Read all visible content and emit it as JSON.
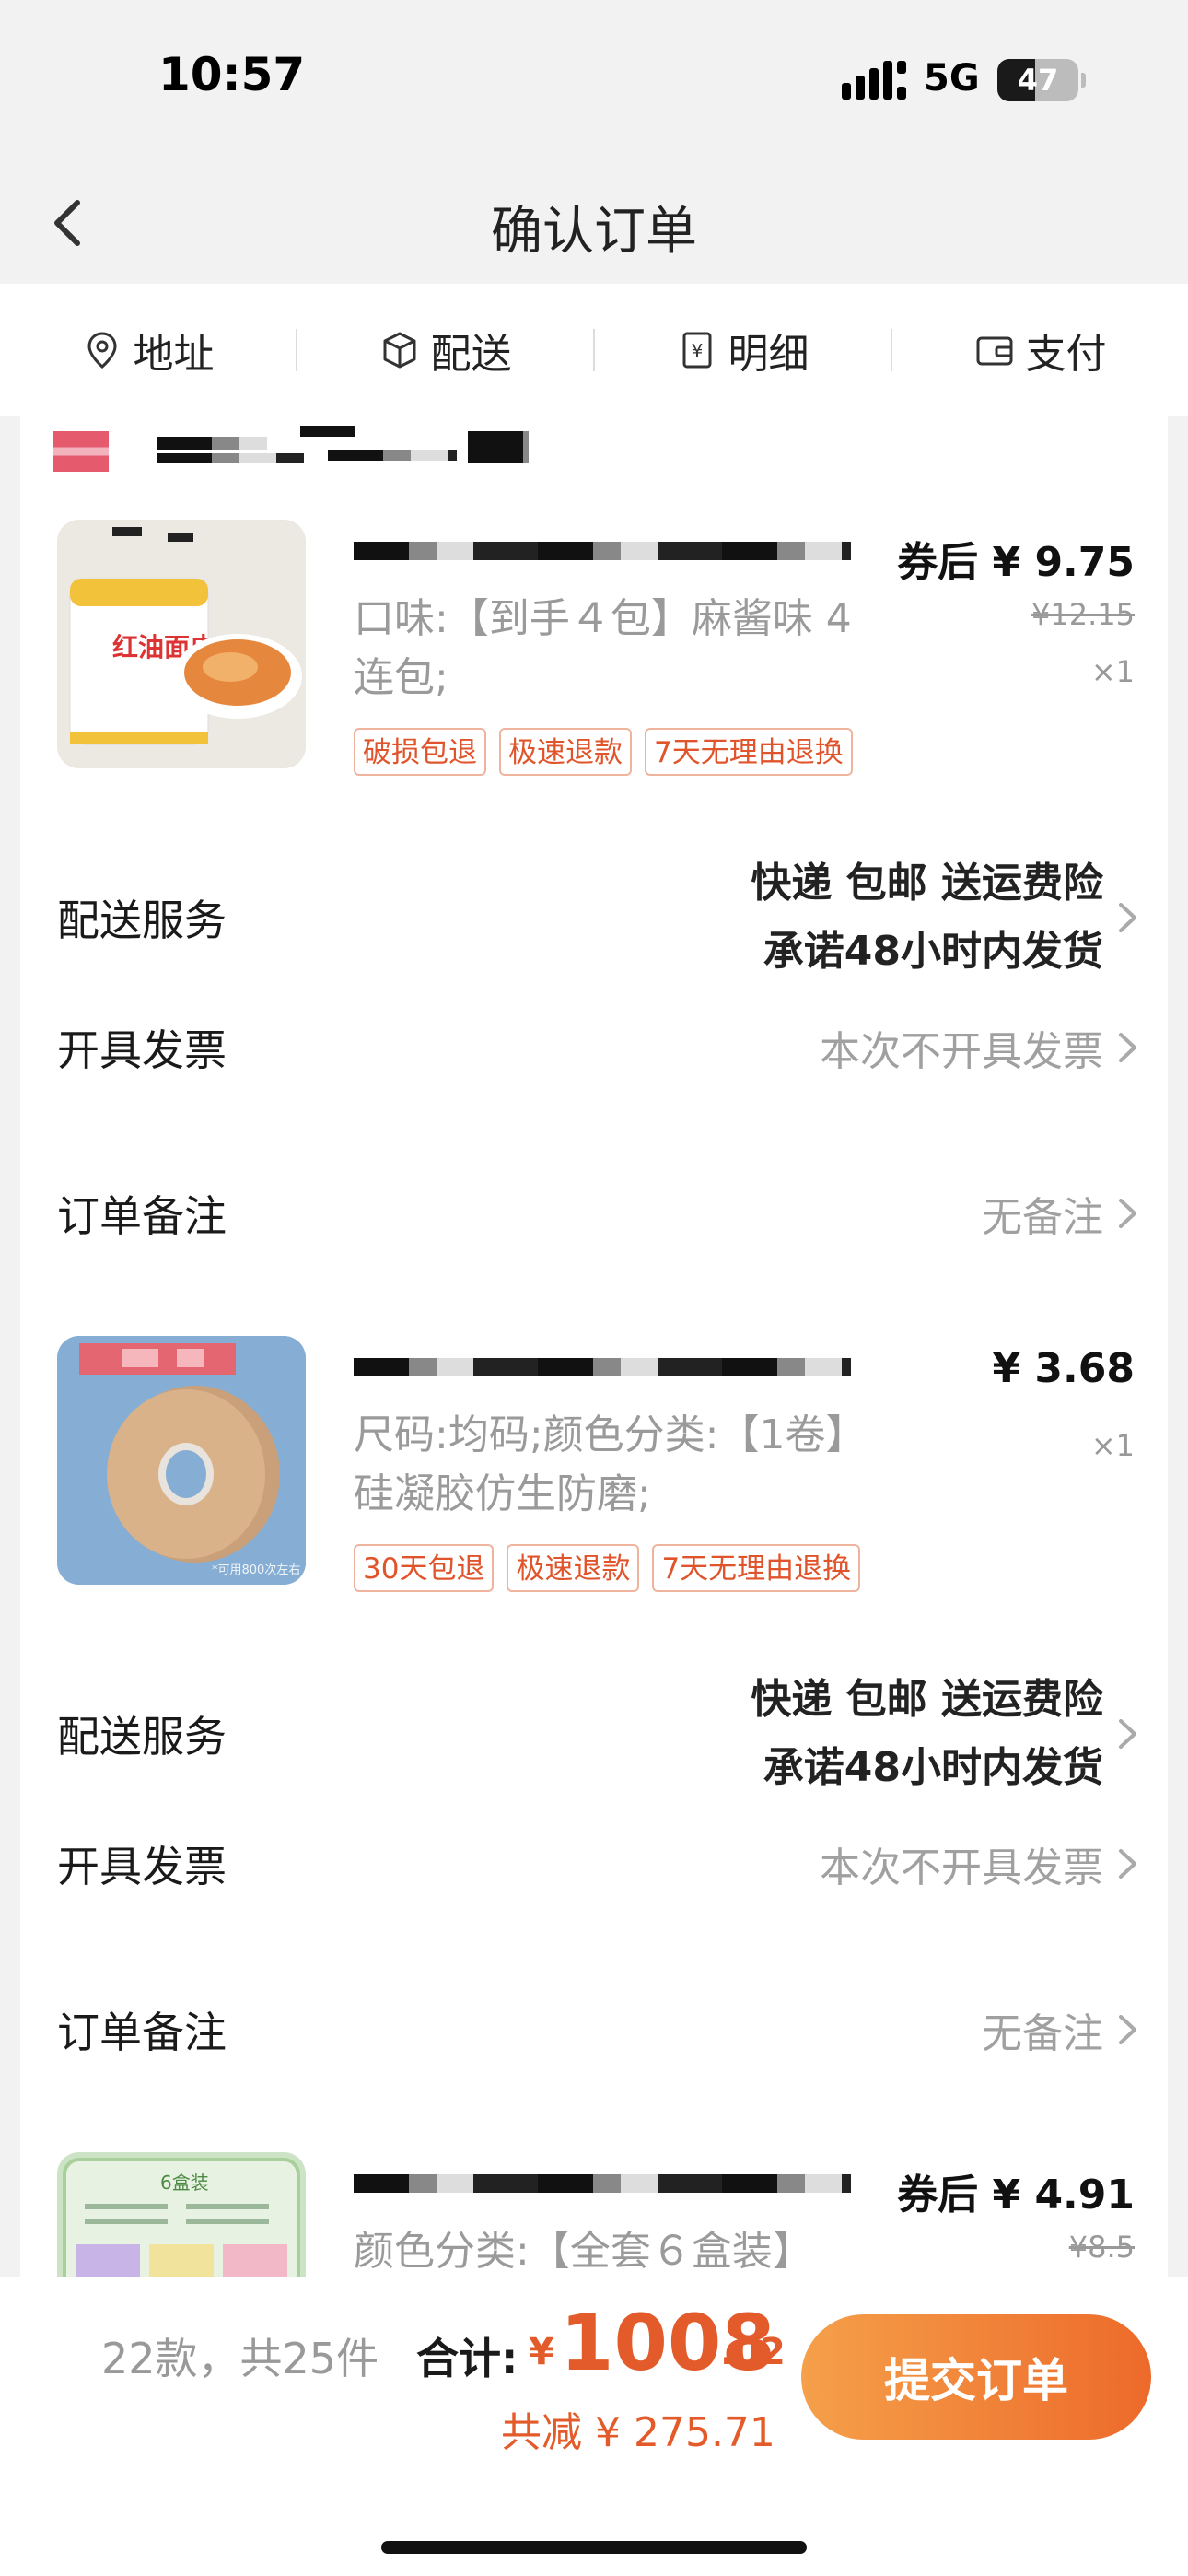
{
  "status": {
    "time": "10:57",
    "network": "5G",
    "battery": "47",
    "battery_level": 0.47
  },
  "nav": {
    "title": "确认订单"
  },
  "tabs": [
    {
      "label": "地址",
      "icon": "location-pin-icon"
    },
    {
      "label": "配送",
      "icon": "box-icon"
    },
    {
      "label": "明细",
      "icon": "receipt-icon"
    },
    {
      "label": "支付",
      "icon": "wallet-icon"
    }
  ],
  "items": [
    {
      "price": "券后 ¥ 9.75",
      "original_price": "¥12.15",
      "qty": "×1",
      "spec": "口味:【到手４包】麻酱味 4连包;",
      "tags": [
        "破损包退",
        "极速退款",
        "7天无理由退换"
      ],
      "thumb_text": "红油面皮",
      "delivery_label": "配送服务",
      "delivery_line1": "快递 包邮 送运费险",
      "delivery_line2": "承诺48小时内发货",
      "invoice_label": "开具发票",
      "invoice_value": "本次不开具发票",
      "note_label": "订单备注",
      "note_value": "无备注"
    },
    {
      "price": "¥ 3.68",
      "qty": "×1",
      "spec": "尺码:均码;颜色分类:【1卷】硅凝胶仿生防磨;",
      "tags": [
        "30天包退",
        "极速退款",
        "7天无理由退换"
      ],
      "thumb_text": "*可用800次左右",
      "delivery_label": "配送服务",
      "delivery_line1": "快递 包邮 送运费险",
      "delivery_line2": "承诺48小时内发货",
      "invoice_label": "开具发票",
      "invoice_value": "本次不开具发票",
      "note_label": "订单备注",
      "note_value": "无备注"
    },
    {
      "price": "券后 ¥ 4.91",
      "original_price": "¥8.5",
      "spec": "颜色分类:【全套６盒装】",
      "thumb_text": "6盒装"
    }
  ],
  "footer": {
    "count": "22款，共25件",
    "total_label": "合计:",
    "currency": "¥",
    "total_int": "1008",
    "total_dec": ".02",
    "saved": "共减 ¥ 275.71",
    "submit": "提交订单"
  },
  "colors": {
    "accent": "#e35b2a",
    "button_start": "#f5a04a",
    "button_end": "#ed6a2a"
  }
}
